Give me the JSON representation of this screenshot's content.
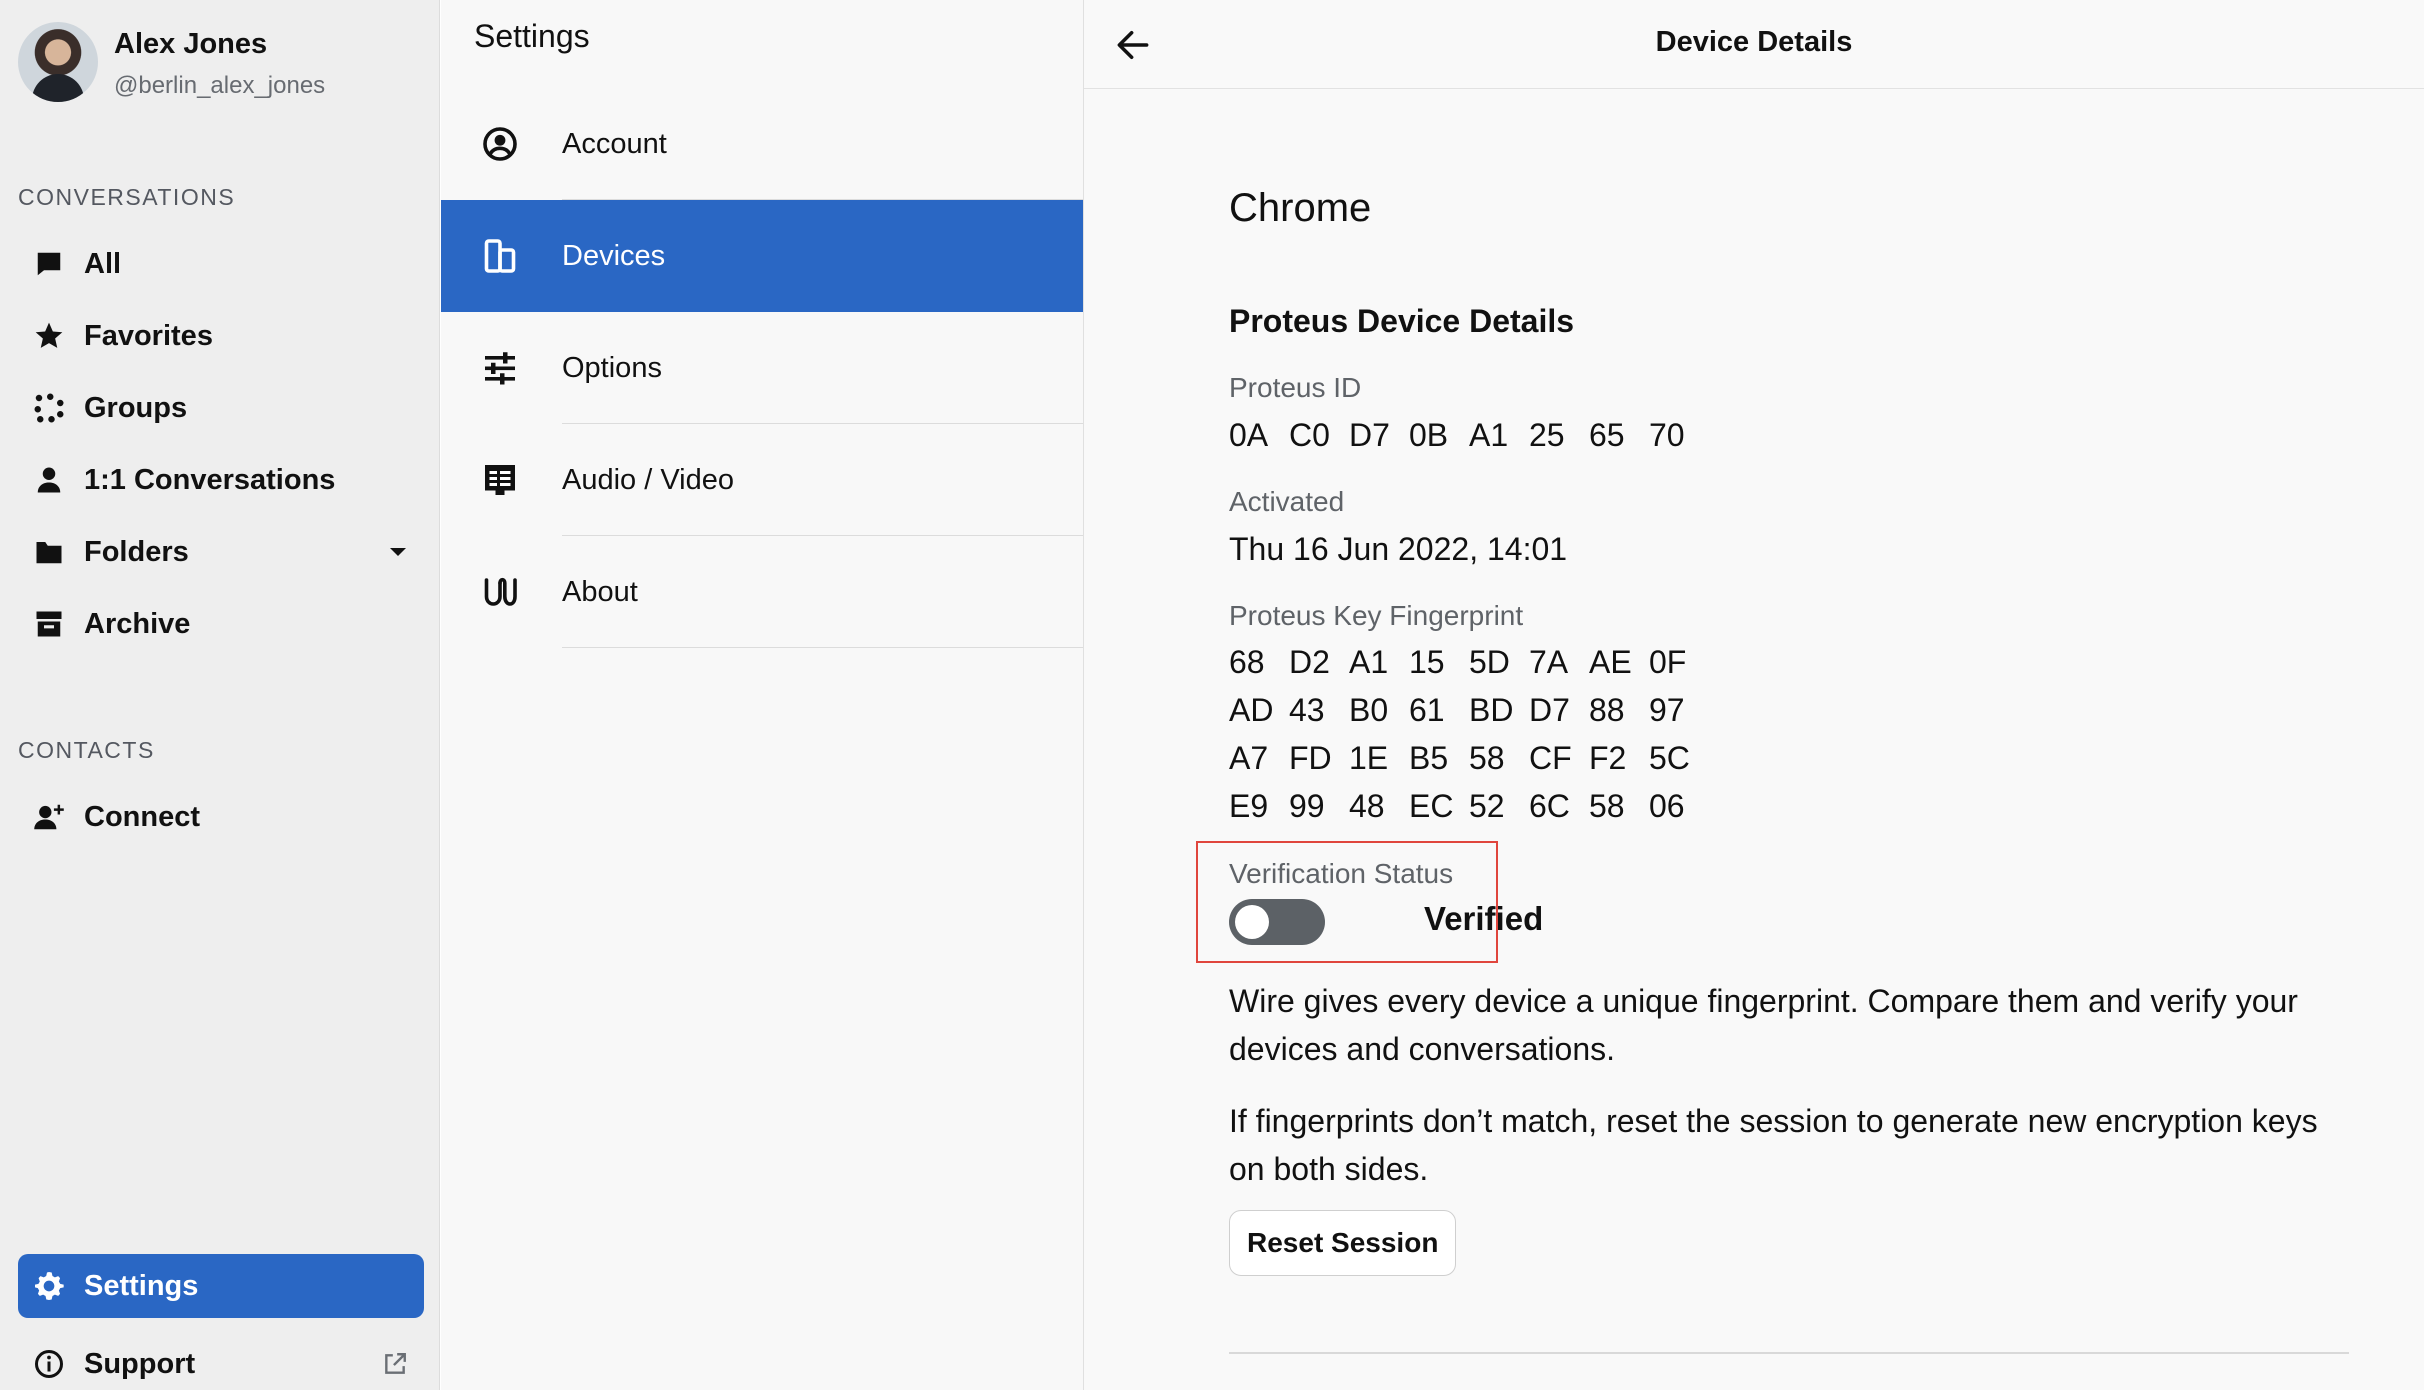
{
  "profile": {
    "name": "Alex Jones",
    "handle": "@berlin_alex_jones"
  },
  "sidebar": {
    "conversations_label": "CONVERSATIONS",
    "items": [
      {
        "label": "All",
        "icon": "chat-bubble-icon"
      },
      {
        "label": "Favorites",
        "icon": "star-icon"
      },
      {
        "label": "Groups",
        "icon": "groups-icon"
      },
      {
        "label": "1:1 Conversations",
        "icon": "person-icon"
      },
      {
        "label": "Folders",
        "icon": "folder-icon"
      },
      {
        "label": "Archive",
        "icon": "archive-icon"
      }
    ],
    "contacts_label": "CONTACTS",
    "connect_label": "Connect",
    "settings_label": "Settings",
    "support_label": "Support"
  },
  "settings": {
    "title": "Settings",
    "items": [
      {
        "label": "Account",
        "icon": "account-circle-icon"
      },
      {
        "label": "Devices",
        "icon": "devices-icon",
        "active": true
      },
      {
        "label": "Options",
        "icon": "sliders-icon"
      },
      {
        "label": "Audio / Video",
        "icon": "audio-video-icon"
      },
      {
        "label": "About",
        "icon": "wire-logo-icon"
      }
    ]
  },
  "detail": {
    "title": "Device Details",
    "device_name": "Chrome",
    "section_heading": "Proteus Device Details",
    "proteus_id_label": "Proteus ID",
    "proteus_id": [
      "0A",
      "C0",
      "D7",
      "0B",
      "A1",
      "25",
      "65",
      "70"
    ],
    "activated_label": "Activated",
    "activated_value": "Thu 16 Jun 2022, 14:01",
    "fingerprint_label": "Proteus Key Fingerprint",
    "fingerprint": [
      [
        "68",
        "D2",
        "A1",
        "15",
        "5D",
        "7A",
        "AE",
        "0F"
      ],
      [
        "AD",
        "43",
        "B0",
        "61",
        "BD",
        "D7",
        "88",
        "97"
      ],
      [
        "A7",
        "FD",
        "1E",
        "B5",
        "58",
        "CF",
        "F2",
        "5C"
      ],
      [
        "E9",
        "99",
        "48",
        "EC",
        "52",
        "6C",
        "58",
        "06"
      ]
    ],
    "verification_label": "Verification Status",
    "verification_value": "Verified",
    "verified_toggle_on": false,
    "paragraph1": "Wire gives every device a unique fingerprint. Compare them and verify your devices and conversations.",
    "paragraph2": "If fingerprints don’t match, reset the session to generate new encryption keys on both sides.",
    "reset_button": "Reset Session"
  },
  "colors": {
    "accent": "#2a67c4",
    "highlight_border": "#e0463d",
    "toggle_off": "#5c6166"
  }
}
